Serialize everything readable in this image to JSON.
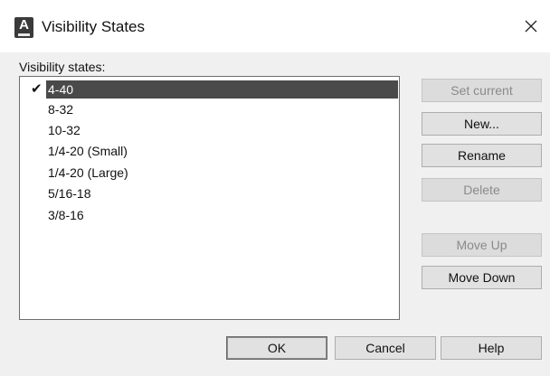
{
  "window": {
    "title": "Visibility States",
    "app_icon": "autocad-app-icon",
    "app_icon_letter": "A",
    "close_icon": "close-icon"
  },
  "states_label": "Visibility states:",
  "states": [
    {
      "label": "4-40",
      "current": true,
      "selected": true
    },
    {
      "label": "8-32",
      "current": false,
      "selected": false
    },
    {
      "label": "10-32",
      "current": false,
      "selected": false
    },
    {
      "label": "1/4-20 (Small)",
      "current": false,
      "selected": false
    },
    {
      "label": "1/4-20 (Large)",
      "current": false,
      "selected": false
    },
    {
      "label": "5/16-18",
      "current": false,
      "selected": false
    },
    {
      "label": "3/8-16",
      "current": false,
      "selected": false
    }
  ],
  "side_buttons": {
    "set_current": "Set current",
    "new": "New...",
    "rename": "Rename",
    "delete": "Delete",
    "move_up": "Move Up",
    "move_down": "Move Down"
  },
  "footer_buttons": {
    "ok": "OK",
    "cancel": "Cancel",
    "help": "Help"
  },
  "colors": {
    "selection": "#4a4a4a",
    "dialog_bg": "#f0f0f0"
  }
}
